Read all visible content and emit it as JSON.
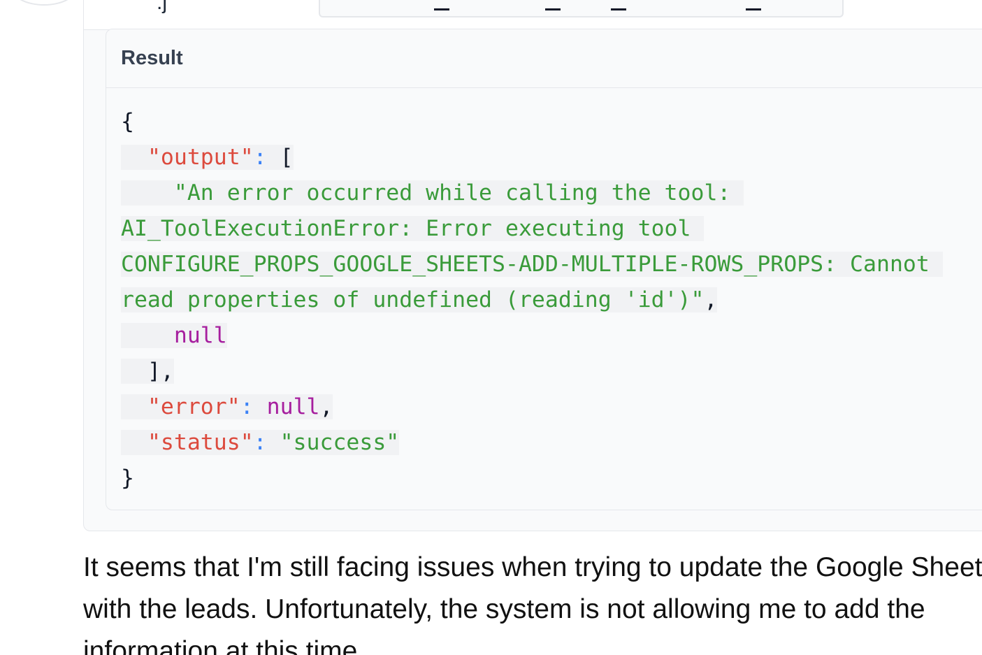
{
  "result_card": {
    "title": "Result"
  },
  "result_json": {
    "open_brace": "{",
    "output_key": "\"output\"",
    "colon": ":",
    "open_bracket": "[",
    "output_value_line1": "\"An error occurred while calling the tool:",
    "output_value_line2": "AI_ToolExecutionError: Error executing tool",
    "output_value_line3": "CONFIGURE_PROPS_GOOGLE_SHEETS-ADD-MULTIPLE-ROWS_PROPS: Cannot",
    "output_value_line4": "read properties of undefined (reading 'id')\"",
    "comma": ",",
    "null_value": "null",
    "close_bracket": "]",
    "error_key": "\"error\"",
    "status_key": "\"status\"",
    "status_value": "\"success\"",
    "close_brace": "}"
  },
  "assistant_message": {
    "line1": "It seems that I'm still facing issues when trying to update the Google Sheet",
    "line2": "with the leads. Unfortunately, the system is not allowing me to add the",
    "line3": "information at this time."
  }
}
